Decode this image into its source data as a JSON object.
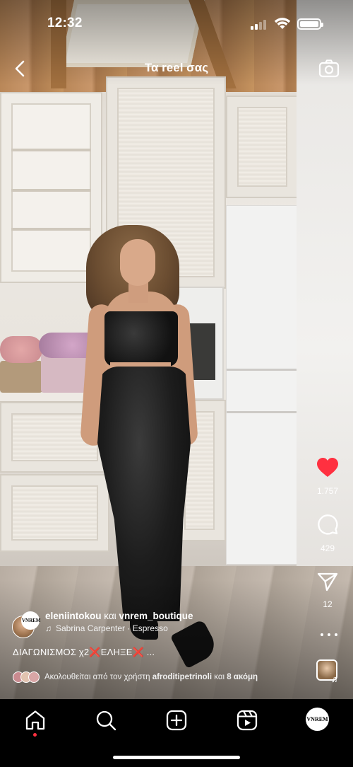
{
  "status_bar": {
    "time": "12:32"
  },
  "header": {
    "title": "Τα reel σας"
  },
  "actions": {
    "likes": "1.757",
    "comments": "429",
    "shares": "12",
    "like_color": "#ff3040"
  },
  "caption": {
    "author1": "eleniintokou",
    "and_word": "και",
    "author2": "vnrem_boutique",
    "brand_avatar_text": "VNREM",
    "music_artist": "Sabrina Carpenter",
    "music_separator": "·",
    "music_title": "Espresso",
    "text_part1": "ΔΙΑΓΩΝΙΣΜΟΣ χ2",
    "text_cross1": "❌",
    "text_part2": "ΕΛΗΞΕ",
    "text_cross2": "❌",
    "text_ellipsis": "...",
    "followers_prefix": "Ακολουθείται από τον χρήστη",
    "followers_user": "afroditipetrinoli",
    "followers_and": "και",
    "followers_more": "8 ακόμη"
  },
  "nav": {
    "items": [
      "home-icon",
      "search-icon",
      "create-icon",
      "reels-icon",
      "profile-avatar"
    ],
    "profile_avatar_text": "VNREM",
    "active_dot_color": "#ff3040"
  }
}
